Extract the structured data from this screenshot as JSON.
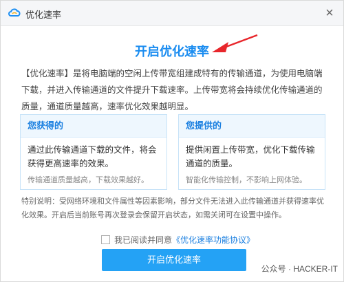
{
  "window": {
    "title": "优化速率",
    "app_icon": "cloud-icon",
    "close_label": "×"
  },
  "heading": "开启优化速率",
  "description": "【优化速率】是将电脑端的空闲上传带宽组建成特有的传输通道，为使用电脑端下载，并进入传输通道的文件提升下载速率。上传带宽将会持续优化传输通道的质量，通道质量越高，速率优化效果越明显。",
  "cards": {
    "gain": {
      "title": "您获得的",
      "main": "通过此传输通道下载的文件，将会获得更高速率的效果。",
      "note": "传输通道质量越高，下载效果越好。"
    },
    "provide": {
      "title": "您提供的",
      "main": "提供闲置上传带宽，优化下载传输通道的质量。",
      "note": "智能化传输控制，不影响上网体验。"
    }
  },
  "special_note": "特别说明：受网络环境和文件属性等因素影响，部分文件无法进入此传输通道并获得速率优化效果。开启后当前账号再次登录会保留开启状态，如需关闭可在设置中操作。",
  "agreement": {
    "checked": false,
    "prefix": "我已阅读并同意",
    "link": "《优化速率功能协议》"
  },
  "primary_button": "开启优化速率",
  "watermark": "公众号 · HACKER-IT",
  "colors": {
    "accent": "#1a8cf0",
    "button": "#24a2f5",
    "arrow": "#e8262b",
    "card_border": "#c7e3f8"
  }
}
